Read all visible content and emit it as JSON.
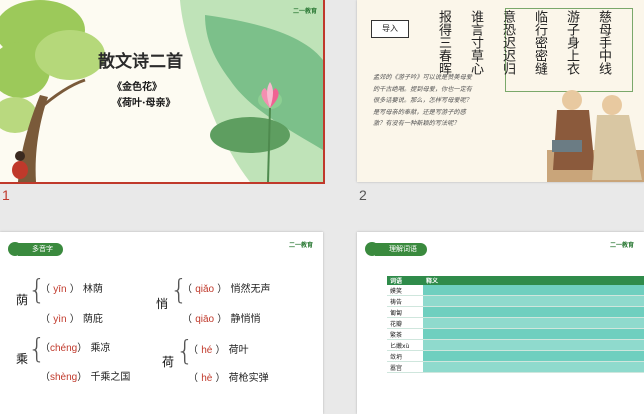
{
  "slides": [
    {
      "number": "1",
      "title": "散文诗二首",
      "items": [
        "《金色花》",
        "《荷叶·母亲》"
      ],
      "logo": "二一教育"
    },
    {
      "number": "2",
      "intro_button": "导入",
      "poem_columns": [
        "慈母手中线",
        "游子身上衣",
        "临行密密缝",
        "意恐迟迟归",
        "谁言寸草心",
        "报得三春晖"
      ],
      "prose": "孟郊的《游子吟》可以说是赞美母爱的千古绝唱。提到母爱，你也一定有很多话要说。那么，怎样写母爱呢？是写母亲的奉献，还是写游子的感激？有没有一种新颖的写法呢？"
    },
    {
      "number": "",
      "header": "多音字",
      "logo": "二一教育",
      "groups": [
        {
          "char": "荫",
          "rows": [
            {
              "py": "yīn",
              "word": "林荫"
            },
            {
              "py": "yìn",
              "word": "荫庇"
            }
          ]
        },
        {
          "char": "悄",
          "rows": [
            {
              "py": "qiǎo",
              "word": "悄然无声"
            },
            {
              "py": "qiāo",
              "word": "静悄悄"
            }
          ]
        },
        {
          "char": "乘",
          "rows": [
            {
              "py": "chéng",
              "word": "乘凉"
            },
            {
              "py": "shèng",
              "word": "千乘之国"
            }
          ]
        },
        {
          "char": "荷",
          "rows": [
            {
              "py": "hé",
              "word": "荷叶"
            },
            {
              "py": "hè",
              "word": "荷枪实弹"
            }
          ]
        }
      ]
    },
    {
      "number": "",
      "header": "理解词语",
      "logo": "二一教育",
      "columns": [
        "词语",
        "释义"
      ],
      "rows": [
        "嫫笑",
        "祷告",
        "匍匐",
        "花瓣",
        "繁茶",
        "匕嫩xù",
        "敛坍",
        "嚣宫"
      ]
    }
  ],
  "colors": {
    "accent_green": "#3a8a3e",
    "selected_border": "#c0392b",
    "pinyin_red": "#c0392b"
  }
}
